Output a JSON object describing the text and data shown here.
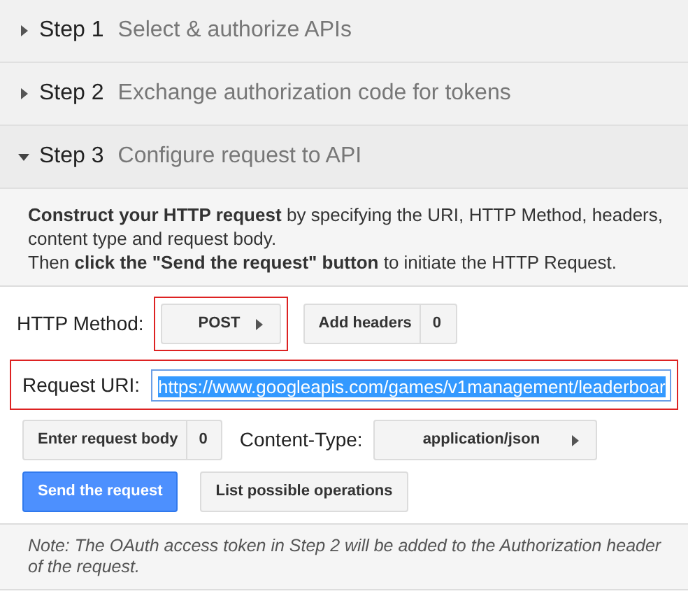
{
  "steps": [
    {
      "number": "Step 1",
      "title": "Select & authorize APIs",
      "expanded": false
    },
    {
      "number": "Step 2",
      "title": "Exchange authorization code for tokens",
      "expanded": false
    },
    {
      "number": "Step 3",
      "title": "Configure request to API",
      "expanded": true
    }
  ],
  "intro": [
    "**Construct your HTTP request** by specifying the URI, HTTP Method, headers, content type and request body.",
    "Then **click the \"Send the request\" button** to initiate the HTTP Request."
  ],
  "method": {
    "label": "HTTP Method:",
    "value": "POST",
    "annotated": true
  },
  "add_headers": {
    "label": "Add headers",
    "count": "0"
  },
  "request_uri": {
    "label": "Request URI:",
    "value": "https://www.googleapis.com/games/v1management/leaderboar",
    "text_selected": true,
    "annotated": true
  },
  "request_body": {
    "label": "Enter request body",
    "count": "0"
  },
  "content_type": {
    "label": "Content-Type:",
    "value": "application/json"
  },
  "buttons": [
    {
      "label": "Send the request",
      "kind": "primary"
    },
    {
      "label": "List possible operations",
      "kind": "secondary"
    }
  ],
  "note": "Note: The OAuth access token in Step 2 will be added to the Authorization header of the request."
}
